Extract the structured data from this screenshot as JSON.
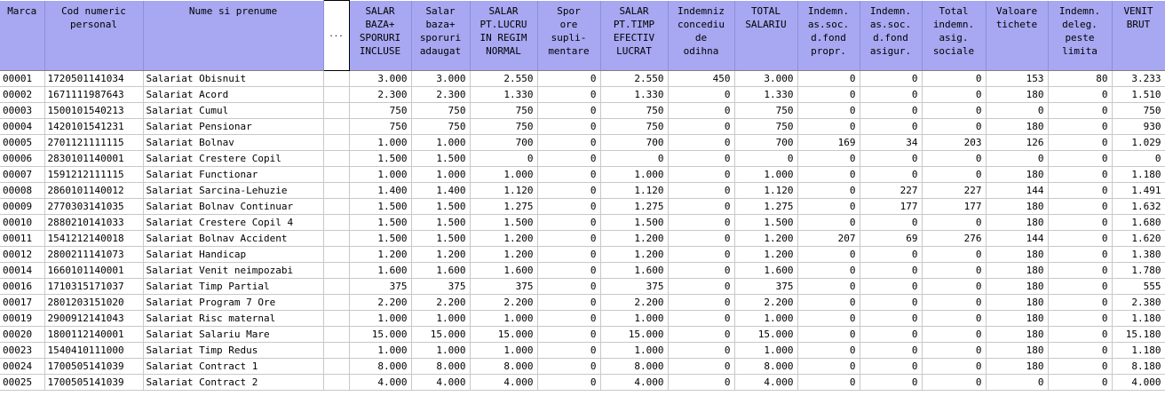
{
  "header": {
    "marca": "Marca",
    "cod": "Cod numeric\npersonal",
    "nume": "Nume si prenume",
    "ellipsis": "...",
    "salar_baza": "SALAR\nBAZA+\nSPORURI\nINCLUSE",
    "salar_baza_spor": "Salar\nbaza+\nsporuri\nadaugat",
    "salar_regim": "SALAR\nPT.LUCRU\nIN REGIM\nNORMAL",
    "spor_ore": "Spor\nore\nsupli-\nmentare",
    "salar_timp": "SALAR\nPT.TIMP\nEFECTIV\nLUCRAT",
    "indemniz_co": "Indemniz\nconcediu\nde\nodihna",
    "total_salariu": "TOTAL\nSALARIU",
    "indemn_fond_propr": "Indemn.\nas.soc.\nd.fond\npropr.",
    "indemn_fond_asig": "Indemn.\nas.soc.\nd.fond\nasigur.",
    "total_indemn": "Total\nindemn.\nasig.\nsociale",
    "valoare_tichete": "Valoare\ntichete",
    "indemn_deleg": "Indemn.\ndeleg.\npeste\nlimita",
    "venit_brut": "VENIT\nBRUT"
  },
  "rows": [
    [
      "00001",
      "1720501141034",
      "Salariat Obisnuit",
      "3.000",
      "3.000",
      "2.550",
      "0",
      "2.550",
      "450",
      "3.000",
      "0",
      "0",
      "0",
      "153",
      "80",
      "3.233"
    ],
    [
      "00002",
      "1671111987643",
      "Salariat Acord",
      "2.300",
      "2.300",
      "1.330",
      "0",
      "1.330",
      "0",
      "1.330",
      "0",
      "0",
      "0",
      "180",
      "0",
      "1.510"
    ],
    [
      "00003",
      "1500101540213",
      "Salariat Cumul",
      "750",
      "750",
      "750",
      "0",
      "750",
      "0",
      "750",
      "0",
      "0",
      "0",
      "0",
      "0",
      "750"
    ],
    [
      "00004",
      "1420101541231",
      "Salariat Pensionar",
      "750",
      "750",
      "750",
      "0",
      "750",
      "0",
      "750",
      "0",
      "0",
      "0",
      "180",
      "0",
      "930"
    ],
    [
      "00005",
      "2701121111115",
      "Salariat Bolnav",
      "1.000",
      "1.000",
      "700",
      "0",
      "700",
      "0",
      "700",
      "169",
      "34",
      "203",
      "126",
      "0",
      "1.029"
    ],
    [
      "00006",
      "2830101140001",
      "Salariat Crestere Copil",
      "1.500",
      "1.500",
      "0",
      "0",
      "0",
      "0",
      "0",
      "0",
      "0",
      "0",
      "0",
      "0",
      "0"
    ],
    [
      "00007",
      "1591212111115",
      "Salariat Functionar",
      "1.000",
      "1.000",
      "1.000",
      "0",
      "1.000",
      "0",
      "1.000",
      "0",
      "0",
      "0",
      "180",
      "0",
      "1.180"
    ],
    [
      "00008",
      "2860101140012",
      "Salariat Sarcina-Lehuzie",
      "1.400",
      "1.400",
      "1.120",
      "0",
      "1.120",
      "0",
      "1.120",
      "0",
      "227",
      "227",
      "144",
      "0",
      "1.491"
    ],
    [
      "00009",
      "2770303141035",
      "Salariat Bolnav Continuar",
      "1.500",
      "1.500",
      "1.275",
      "0",
      "1.275",
      "0",
      "1.275",
      "0",
      "177",
      "177",
      "180",
      "0",
      "1.632"
    ],
    [
      "00010",
      "2880210141033",
      "Salariat Crestere Copil 4",
      "1.500",
      "1.500",
      "1.500",
      "0",
      "1.500",
      "0",
      "1.500",
      "0",
      "0",
      "0",
      "180",
      "0",
      "1.680"
    ],
    [
      "00011",
      "1541212140018",
      "Salariat Bolnav Accident",
      "1.500",
      "1.500",
      "1.200",
      "0",
      "1.200",
      "0",
      "1.200",
      "207",
      "69",
      "276",
      "144",
      "0",
      "1.620"
    ],
    [
      "00012",
      "2800211141073",
      "Salariat Handicap",
      "1.200",
      "1.200",
      "1.200",
      "0",
      "1.200",
      "0",
      "1.200",
      "0",
      "0",
      "0",
      "180",
      "0",
      "1.380"
    ],
    [
      "00014",
      "1660101140001",
      "Salariat Venit neimpozabi",
      "1.600",
      "1.600",
      "1.600",
      "0",
      "1.600",
      "0",
      "1.600",
      "0",
      "0",
      "0",
      "180",
      "0",
      "1.780"
    ],
    [
      "00016",
      "1710315171037",
      "Salariat Timp Partial",
      "375",
      "375",
      "375",
      "0",
      "375",
      "0",
      "375",
      "0",
      "0",
      "0",
      "180",
      "0",
      "555"
    ],
    [
      "00017",
      "2801203151020",
      "Salariat Program 7 Ore",
      "2.200",
      "2.200",
      "2.200",
      "0",
      "2.200",
      "0",
      "2.200",
      "0",
      "0",
      "0",
      "180",
      "0",
      "2.380"
    ],
    [
      "00019",
      "2900912141043",
      "Salariat Risc maternal",
      "1.000",
      "1.000",
      "1.000",
      "0",
      "1.000",
      "0",
      "1.000",
      "0",
      "0",
      "0",
      "180",
      "0",
      "1.180"
    ],
    [
      "00020",
      "1800112140001",
      "Salariat Salariu Mare",
      "15.000",
      "15.000",
      "15.000",
      "0",
      "15.000",
      "0",
      "15.000",
      "0",
      "0",
      "0",
      "180",
      "0",
      "15.180"
    ],
    [
      "00023",
      "1540410111000",
      "Salariat Timp Redus",
      "1.000",
      "1.000",
      "1.000",
      "0",
      "1.000",
      "0",
      "1.000",
      "0",
      "0",
      "0",
      "180",
      "0",
      "1.180"
    ],
    [
      "00024",
      "1700505141039",
      "Salariat Contract 1",
      "8.000",
      "8.000",
      "8.000",
      "0",
      "8.000",
      "0",
      "8.000",
      "0",
      "0",
      "0",
      "180",
      "0",
      "8.180"
    ],
    [
      "00025",
      "1700505141039",
      "Salariat Contract 2",
      "4.000",
      "4.000",
      "4.000",
      "0",
      "4.000",
      "0",
      "4.000",
      "0",
      "0",
      "0",
      "0",
      "0",
      "4.000"
    ]
  ]
}
